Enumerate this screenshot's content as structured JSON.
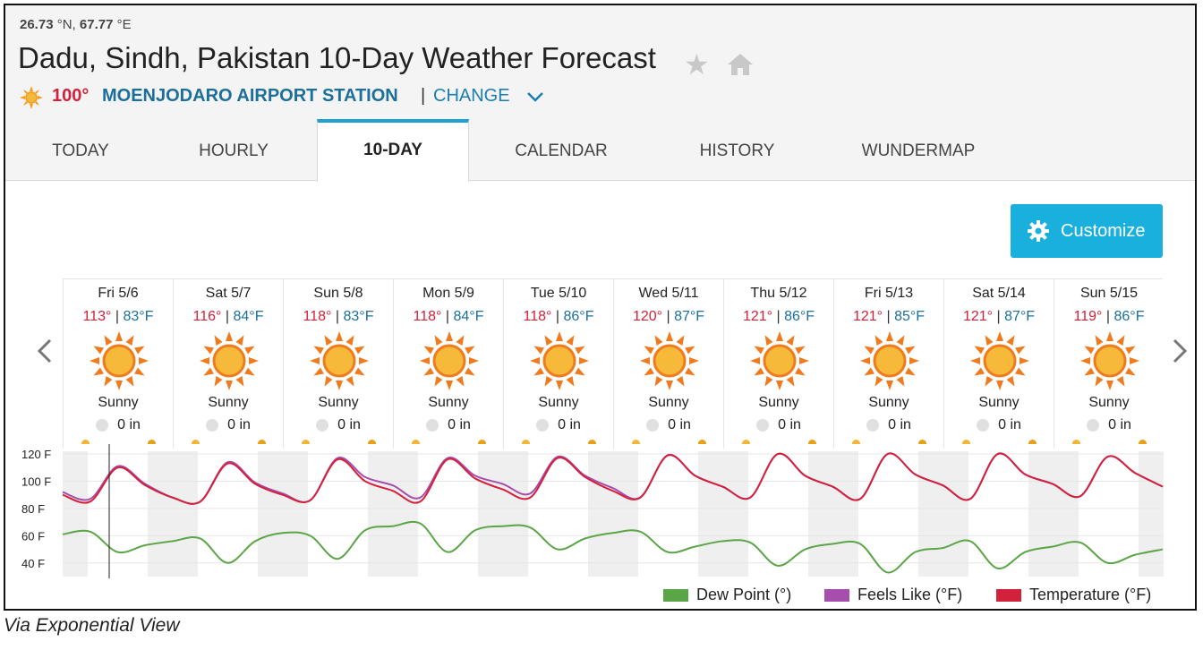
{
  "header": {
    "lat": "26.73",
    "lat_unit": "°N,",
    "lon": "67.77",
    "lon_unit": "°E",
    "title": "Dadu, Sindh, Pakistan 10-Day Weather Forecast",
    "star_icon": "star-icon",
    "home_icon": "home-icon",
    "current_temp": "100°",
    "station": "MOENJODARO AIRPORT STATION",
    "separator": "|",
    "change_label": "CHANGE"
  },
  "tabs": [
    {
      "label": "TODAY",
      "active": false
    },
    {
      "label": "HOURLY",
      "active": false
    },
    {
      "label": "10-DAY",
      "active": true
    },
    {
      "label": "CALENDAR",
      "active": false
    },
    {
      "label": "HISTORY",
      "active": false
    },
    {
      "label": "WUNDERMAP",
      "active": false
    }
  ],
  "customize_label": "Customize",
  "days": [
    {
      "name": "Fri 5/6",
      "hi": "113°",
      "lo": "83°F",
      "condition": "Sunny",
      "precip": "0 in"
    },
    {
      "name": "Sat 5/7",
      "hi": "116°",
      "lo": "84°F",
      "condition": "Sunny",
      "precip": "0 in"
    },
    {
      "name": "Sun 5/8",
      "hi": "118°",
      "lo": "83°F",
      "condition": "Sunny",
      "precip": "0 in"
    },
    {
      "name": "Mon 5/9",
      "hi": "118°",
      "lo": "84°F",
      "condition": "Sunny",
      "precip": "0 in"
    },
    {
      "name": "Tue 5/10",
      "hi": "118°",
      "lo": "86°F",
      "condition": "Sunny",
      "precip": "0 in"
    },
    {
      "name": "Wed 5/11",
      "hi": "120°",
      "lo": "87°F",
      "condition": "Sunny",
      "precip": "0 in"
    },
    {
      "name": "Thu 5/12",
      "hi": "121°",
      "lo": "86°F",
      "condition": "Sunny",
      "precip": "0 in"
    },
    {
      "name": "Fri 5/13",
      "hi": "121°",
      "lo": "85°F",
      "condition": "Sunny",
      "precip": "0 in"
    },
    {
      "name": "Sat 5/14",
      "hi": "121°",
      "lo": "87°F",
      "condition": "Sunny",
      "precip": "0 in"
    },
    {
      "name": "Sun 5/15",
      "hi": "119°",
      "lo": "86°F",
      "condition": "Sunny",
      "precip": "0 in"
    }
  ],
  "colors": {
    "hi": "#d3203b",
    "lo": "#1c6f9a",
    "accent": "#1ab0dd",
    "temperature": "#d3203b",
    "feels_like": "#a64dad",
    "dew_point": "#5aa545"
  },
  "chart_data": {
    "type": "line",
    "y_ticks": [
      "120 F",
      "100 F",
      "80 F",
      "60 F",
      "40 F"
    ],
    "ylim": [
      30,
      122
    ],
    "x": [
      "5/6 00:00",
      "5/6 06:00",
      "5/6 12:00",
      "5/6 18:00",
      "5/7 00:00",
      "5/7 06:00",
      "5/7 12:00",
      "5/7 18:00",
      "5/8 00:00",
      "5/8 06:00",
      "5/8 12:00",
      "5/8 18:00",
      "5/9 00:00",
      "5/9 06:00",
      "5/9 12:00",
      "5/9 18:00",
      "5/10 00:00",
      "5/10 06:00",
      "5/10 12:00",
      "5/10 18:00",
      "5/11 00:00",
      "5/11 06:00",
      "5/11 12:00",
      "5/11 18:00",
      "5/12 00:00",
      "5/12 06:00",
      "5/12 12:00",
      "5/12 18:00",
      "5/13 00:00",
      "5/13 06:00",
      "5/13 12:00",
      "5/13 18:00",
      "5/14 00:00",
      "5/14 06:00",
      "5/14 12:00",
      "5/14 18:00",
      "5/15 00:00",
      "5/15 06:00",
      "5/15 12:00",
      "5/15 18:00",
      "5/16 00:00"
    ],
    "series": [
      {
        "name": "Temperature (°F)",
        "color": "#d3203b",
        "values": [
          90,
          85,
          110,
          97,
          88,
          85,
          113,
          98,
          90,
          86,
          116,
          100,
          93,
          85,
          116,
          102,
          94,
          88,
          117,
          103,
          93,
          88,
          119,
          104,
          96,
          88,
          120,
          104,
          96,
          87,
          120,
          105,
          97,
          87,
          120,
          105,
          98,
          89,
          118,
          106,
          96
        ]
      },
      {
        "name": "Feels Like (°F)",
        "color": "#a64dad",
        "values": [
          92,
          87,
          111,
          98,
          88,
          85,
          114,
          99,
          91,
          86,
          117,
          103,
          97,
          88,
          117,
          104,
          98,
          91,
          118,
          104,
          95,
          88,
          119,
          104,
          96,
          88,
          120,
          104,
          96,
          87,
          120,
          105,
          97,
          87,
          120,
          105,
          98,
          89,
          118,
          106,
          96
        ]
      },
      {
        "name": "Dew Point (°)",
        "color": "#5aa545",
        "values": [
          61,
          63,
          48,
          53,
          56,
          58,
          40,
          56,
          62,
          60,
          43,
          64,
          67,
          69,
          48,
          64,
          67,
          66,
          50,
          58,
          62,
          63,
          48,
          52,
          56,
          55,
          38,
          50,
          54,
          54,
          33,
          48,
          51,
          56,
          36,
          48,
          52,
          55,
          40,
          46,
          50
        ]
      }
    ]
  }
}
